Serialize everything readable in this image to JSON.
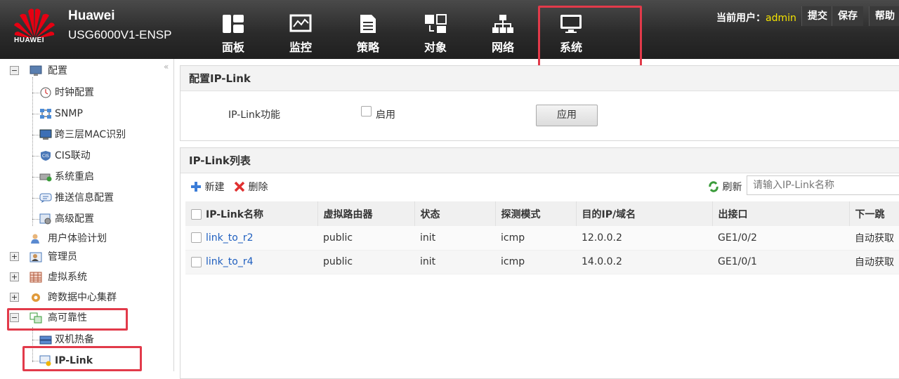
{
  "header": {
    "brand": "Huawei",
    "model": "USG6000V1-ENSP",
    "logo_text": "HUAWEI",
    "nav": [
      {
        "label": "面板",
        "icon": "dashboard-icon"
      },
      {
        "label": "监控",
        "icon": "monitor-chart-icon"
      },
      {
        "label": "策略",
        "icon": "policy-document-icon"
      },
      {
        "label": "对象",
        "icon": "object-icon"
      },
      {
        "label": "网络",
        "icon": "network-icon"
      },
      {
        "label": "系统",
        "icon": "system-monitor-icon"
      }
    ],
    "current_user_label": "当前用户：",
    "current_user": "admin",
    "buttons": {
      "submit": "提交",
      "save": "保存",
      "help": "帮助"
    },
    "highlight_color": "#e23a4a"
  },
  "sidebar": {
    "config": "配置",
    "config_children": [
      "时钟配置",
      "SNMP",
      "跨三层MAC识别",
      "CIS联动",
      "系统重启",
      "推送信息配置",
      "高级配置"
    ],
    "ux_plan": "用户体验计划",
    "admin": "管理员",
    "vsys": "虚拟系统",
    "dc_cluster": "跨数据中心集群",
    "ha": "高可靠性",
    "ha_children": [
      "双机热备",
      "IP-Link"
    ]
  },
  "config_panel": {
    "title": "配置IP-Link",
    "feature_label": "IP-Link功能",
    "enable_label": "启用",
    "apply_label": "应用"
  },
  "list_panel": {
    "title": "IP-Link列表",
    "new_label": "新建",
    "delete_label": "删除",
    "refresh_label": "刷新",
    "search_placeholder": "请输入IP-Link名称",
    "columns": [
      "IP-Link名称",
      "虚拟路由器",
      "状态",
      "探测模式",
      "目的IP/域名",
      "出接口",
      "下一跳"
    ],
    "rows": [
      {
        "name": "link_to_r2",
        "vrouter": "public",
        "status": "init",
        "mode": "icmp",
        "dest": "12.0.0.2",
        "iface": "GE1/0/2",
        "nexthop": "自动获取"
      },
      {
        "name": "link_to_r4",
        "vrouter": "public",
        "status": "init",
        "mode": "icmp",
        "dest": "14.0.0.2",
        "iface": "GE1/0/1",
        "nexthop": "自动获取"
      }
    ]
  }
}
